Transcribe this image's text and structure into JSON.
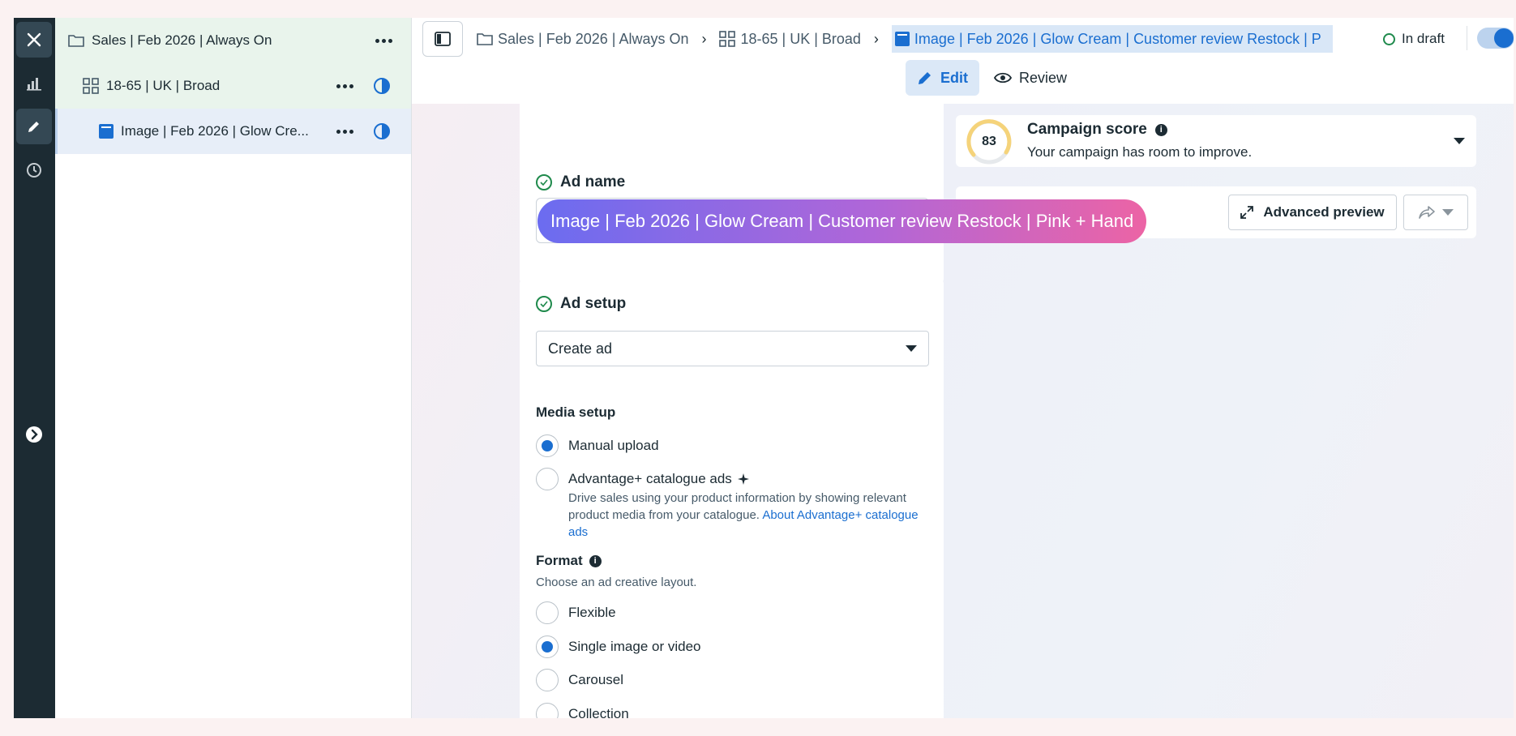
{
  "tree": {
    "campaign_label": "Sales | Feb 2026 | Always On",
    "adset_label": "18-65 | UK | Broad",
    "ad_label": "Image | Feb 2026 | Glow Cre..."
  },
  "breadcrumb": {
    "campaign": "Sales | Feb 2026 | Always On",
    "adset": "18-65 | UK | Broad",
    "ad": "Image | Feb 2026 | Glow Cream | Customer review Restock | P"
  },
  "status": {
    "label": "In draft"
  },
  "modes": {
    "edit": "Edit",
    "review": "Review"
  },
  "ad_name": {
    "title": "Ad name",
    "value": "Image | Feb 2026 | Glow Cream | Customer review Restock | Pink + Hand"
  },
  "ad_setup": {
    "title": "Ad setup",
    "select_value": "Create ad",
    "media_setup_label": "Media setup",
    "manual_upload": "Manual upload",
    "catalogue_ads": "Advantage+ catalogue ads",
    "catalogue_desc": "Drive sales using your product information by showing relevant product media from your catalogue.",
    "catalogue_link": "About Advantage+ catalogue ads",
    "format_label": "Format",
    "format_sub": "Choose an ad creative layout.",
    "formats": [
      "Flexible",
      "Single image or video",
      "Carousel",
      "Collection"
    ],
    "selected_format": "Single image or video",
    "selected_media": "Manual upload"
  },
  "campaign_score": {
    "title": "Campaign score",
    "score": "83",
    "subtitle": "Your campaign has room to improve."
  },
  "preview": {
    "advanced_preview": "Advanced preview"
  },
  "colors": {
    "accent": "#1a6ed0",
    "draft_green": "#1f8a4c",
    "rail_bg": "#1c2b33"
  }
}
